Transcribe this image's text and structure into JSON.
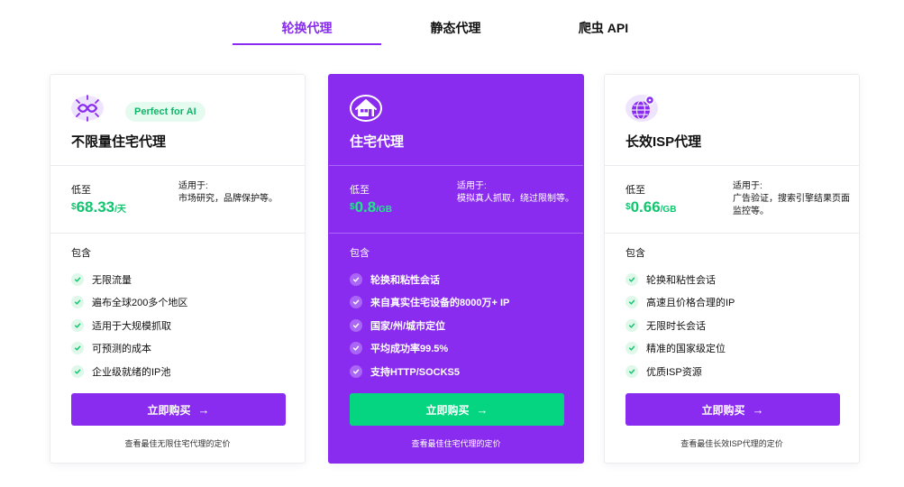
{
  "tabs": [
    {
      "label": "轮换代理",
      "active": true
    },
    {
      "label": "静态代理",
      "active": false
    },
    {
      "label": "爬虫 API",
      "active": false
    }
  ],
  "colors": {
    "accent": "#8a2cf0",
    "green": "#05d480",
    "price_green": "#11c56f"
  },
  "cards": [
    {
      "icon": "unlimited-proxy-icon",
      "badge": "Perfect for AI",
      "title": "不限量住宅代理",
      "from_label": "低至",
      "currency": "$",
      "price": "68.33",
      "unit": "/天",
      "suitable_label": "适用于:",
      "suitable_desc": "市场研究，品牌保护等。",
      "includes_label": "包含",
      "features": [
        "无限流量",
        "遍布全球200多个地区",
        "适用于大规模抓取",
        "可预测的成本",
        "企业级就绪的IP池"
      ],
      "buy_label": "立即购买",
      "view_link": "查看最佳无限住宅代理的定价"
    },
    {
      "icon": "house-icon",
      "title": "住宅代理",
      "from_label": "低至",
      "currency": "$",
      "price": "0.8",
      "unit": "/GB",
      "suitable_label": "适用于:",
      "suitable_desc": "模拟真人抓取，绕过限制等。",
      "includes_label": "包含",
      "features": [
        "轮换和粘性会话",
        "来自真实住宅设备的8000万+ IP",
        "国家/州/城市定位",
        "平均成功率99.5%",
        "支持HTTP/SOCKS5"
      ],
      "buy_label": "立即购买",
      "view_link": "查看最佳住宅代理的定价"
    },
    {
      "icon": "isp-globe-icon",
      "title": "长效ISP代理",
      "from_label": "低至",
      "currency": "$",
      "price": "0.66",
      "unit": "/GB",
      "suitable_label": "适用于:",
      "suitable_desc": "广告验证，搜索引擎结果页面监控等。",
      "includes_label": "包含",
      "features": [
        "轮换和粘性会话",
        "高速且价格合理的IP",
        "无限时长会话",
        "精准的国家级定位",
        "优质ISP资源"
      ],
      "buy_label": "立即购买",
      "view_link": "查看最佳长效ISP代理的定价"
    }
  ]
}
